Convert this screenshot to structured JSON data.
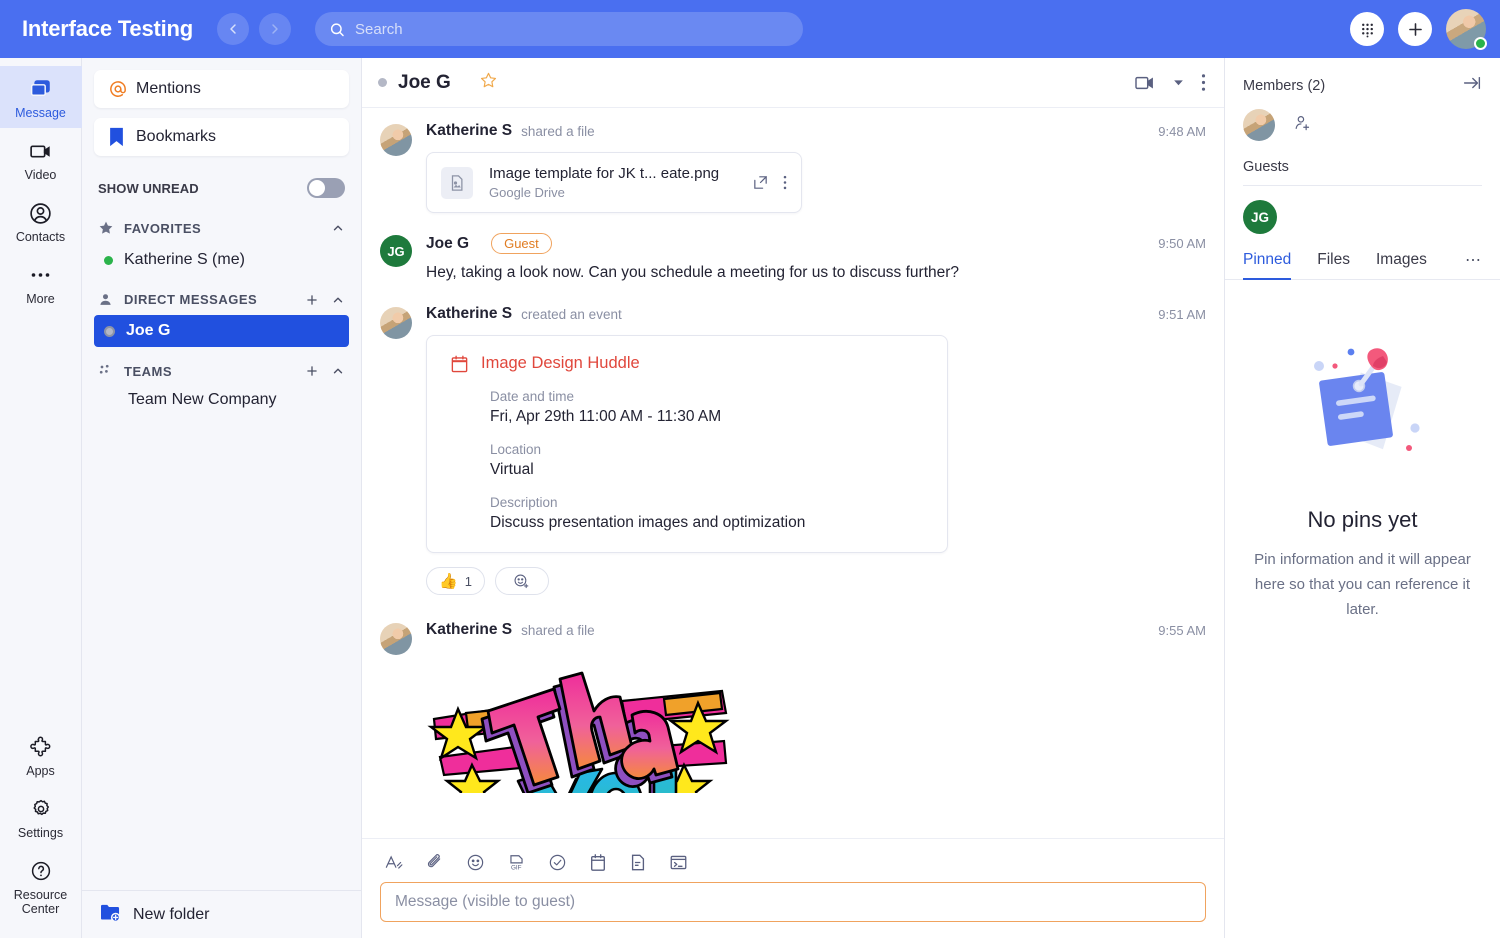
{
  "topbar": {
    "title": "Interface Testing",
    "back_icon": "chevron-left-icon",
    "forward_icon": "chevron-right-icon",
    "search_placeholder": "Search",
    "search_value": "",
    "apps_icon": "grid-dots-icon",
    "add_icon": "plus-icon",
    "avatar_status": "online"
  },
  "rail": {
    "items": [
      {
        "label": "Message",
        "icon": "chat-bubbles-icon",
        "active": true
      },
      {
        "label": "Video",
        "icon": "video-camera-icon",
        "active": false
      },
      {
        "label": "Contacts",
        "icon": "person-circle-icon",
        "active": false
      },
      {
        "label": "More",
        "icon": "ellipsis-icon",
        "active": false
      }
    ],
    "bottom_items": [
      {
        "label": "Apps",
        "icon": "puzzle-piece-icon"
      },
      {
        "label": "Settings",
        "icon": "gear-icon"
      },
      {
        "label": "Resource Center",
        "icon": "question-circle-icon"
      }
    ]
  },
  "sidebar": {
    "mentions_label": "Mentions",
    "mentions_icon": "at-sign-icon",
    "bookmarks_label": "Bookmarks",
    "bookmarks_icon": "bookmark-icon",
    "show_unread_label": "SHOW UNREAD",
    "show_unread_on": false,
    "sections": [
      {
        "label": "FAVORITES",
        "icon": "star-icon",
        "has_add": false,
        "items": [
          {
            "label": "Katherine S (me)",
            "presence": "green",
            "selected": false
          }
        ]
      },
      {
        "label": "DIRECT MESSAGES",
        "icon": "person-icon",
        "has_add": true,
        "items": [
          {
            "label": "Joe G",
            "presence": "gray",
            "selected": true
          }
        ]
      },
      {
        "label": "TEAMS",
        "icon": "team-dots-icon",
        "has_add": true,
        "teams": [
          {
            "label": "Team New Company"
          }
        ]
      }
    ],
    "footer": {
      "label": "New folder",
      "icon": "new-folder-icon"
    }
  },
  "chat": {
    "header": {
      "title": "Joe G",
      "presence": "gray",
      "star_icon": "star-outline-icon",
      "video_icon": "video-camera-icon",
      "caret_icon": "chevron-down-icon",
      "more_icon": "kebab-menu-icon"
    },
    "messages": [
      {
        "author": "Katherine S",
        "avatar": "photo",
        "action": "shared a file",
        "time": "9:48 AM",
        "type": "file",
        "file": {
          "name": "Image template for JK t... eate.png",
          "source": "Google Drive",
          "thumb_icon": "image-file-icon",
          "open_icon": "open-external-icon",
          "more_icon": "kebab-menu-icon"
        }
      },
      {
        "author": "Joe G",
        "avatar": "initials",
        "initials": "JG",
        "badge": "Guest",
        "time": "9:50 AM",
        "type": "text",
        "text": "Hey, taking a look now. Can you schedule a meeting for us to discuss further?"
      },
      {
        "author": "Katherine S",
        "avatar": "photo",
        "action": "created an event",
        "time": "9:51 AM",
        "type": "event",
        "event": {
          "title": "Image Design Huddle",
          "icon": "calendar-icon",
          "fields": [
            {
              "label": "Date and time",
              "value": "Fri, Apr 29th 11:00 AM - 11:30 AM"
            },
            {
              "label": "Location",
              "value": "Virtual"
            },
            {
              "label": "Description",
              "value": "Discuss presentation images and optimization"
            }
          ]
        },
        "reactions": [
          {
            "emoji": "👍",
            "count": "1"
          },
          {
            "emoji": "add",
            "count": ""
          }
        ]
      },
      {
        "author": "Katherine S",
        "avatar": "photo",
        "action": "shared a file",
        "time": "9:55 AM",
        "type": "image",
        "image_alt": "Thank You!"
      }
    ],
    "composer": {
      "placeholder": "Message (visible to guest)",
      "value": "",
      "tools": [
        "format-text-icon",
        "attachment-icon",
        "emoji-icon",
        "gif-icon",
        "task-check-icon",
        "calendar-icon",
        "note-icon",
        "code-snippet-icon"
      ]
    }
  },
  "right_panel": {
    "members_label": "Members (2)",
    "collapse_icon": "collapse-right-icon",
    "add_member_icon": "add-person-icon",
    "guests_label": "Guests",
    "guest_initials": "JG",
    "tabs": [
      {
        "label": "Pinned",
        "active": true
      },
      {
        "label": "Files",
        "active": false
      },
      {
        "label": "Images",
        "active": false
      }
    ],
    "tabs_more": "⋯",
    "empty": {
      "icon": "pinned-note-icon",
      "title": "No pins yet",
      "subtitle": "Pin information and it will appear here so that you can reference it later."
    }
  },
  "colors": {
    "brand_blue": "#4a6ff0",
    "selected_blue": "#2150df",
    "accent_blue": "#2d5bdd",
    "guest_orange": "#e07c22",
    "event_red": "#e0473c",
    "green": "#2bb34b",
    "avatar_green": "#1e7a3c"
  }
}
